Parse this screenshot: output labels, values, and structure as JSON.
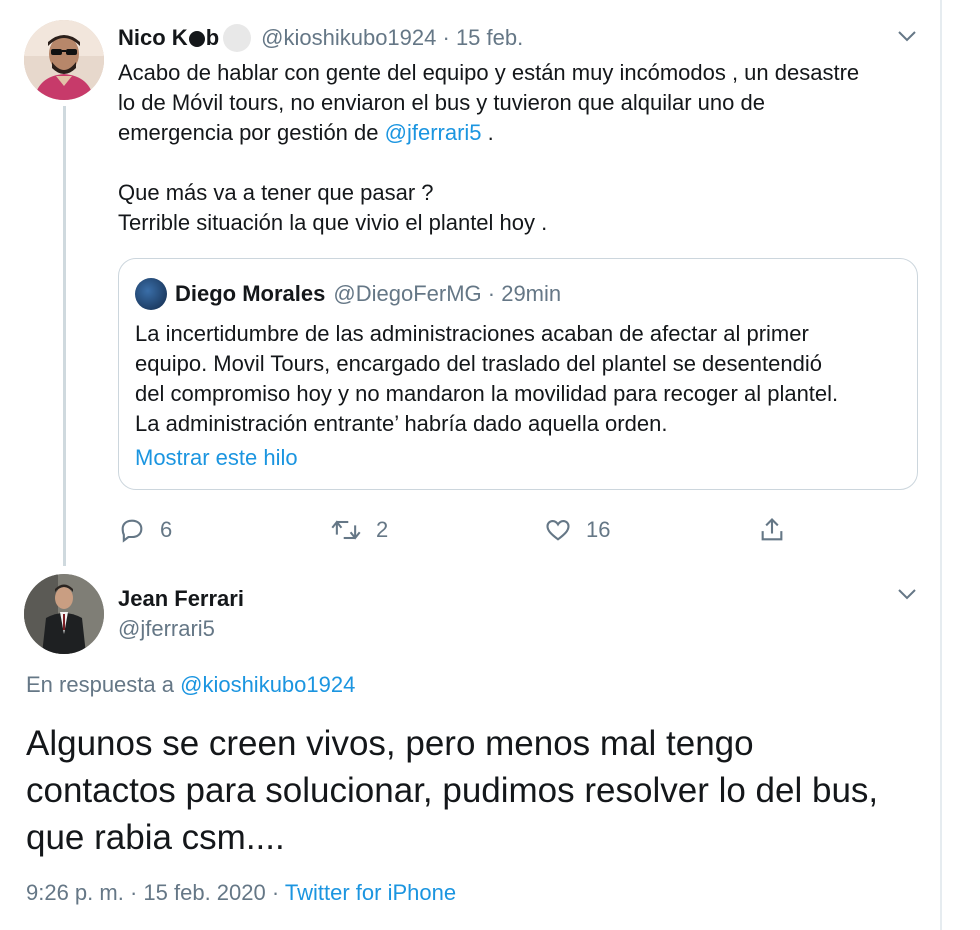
{
  "tweet1": {
    "name": "Nico K",
    "name_tail": "b",
    "handle": "@kioshikubo1924",
    "sep": " · ",
    "date": "15 feb.",
    "text_lines": [
      "Acabo de hablar con gente del equipo y están muy incómodos , un desastre",
      "lo de Móvil tours, no enviaron el bus y tuvieron que alquilar uno de",
      "emergencia por gestión de "
    ],
    "mention": "@jferrari5",
    "after_mention": " .",
    "text2_lines": [
      "Que más va a tener que pasar ?",
      "Terrible situación la que vivio el plantel hoy ."
    ],
    "quote": {
      "name": "Diego Morales",
      "handle": "@DiegoFerMG",
      "sep": " · ",
      "time": "29min",
      "lines": [
        "La incertidumbre de las administraciones acaban de afectar al primer",
        "equipo. Movil Tours, encargado del traslado del plantel se desentendió",
        "del compromiso hoy y no mandaron la movilidad para recoger al plantel.",
        "La administración entrante’ habría dado aquella orden."
      ],
      "show_thread": "Mostrar este hilo"
    },
    "actions": {
      "replies": "6",
      "retweets": "2",
      "likes": "16"
    }
  },
  "tweet2": {
    "name": "Jean Ferrari",
    "handle": "@jferrari5",
    "reply_prefix": "En respuesta a ",
    "reply_handle": "@kioshikubo1924",
    "text_lines": [
      "Algunos se creen vivos, pero menos mal tengo",
      "contactos para solucionar, pudimos resolver lo del bus,",
      "que rabia csm...."
    ],
    "time": "9:26 p. m.",
    "sep1": " · ",
    "date": "15 feb. 2020",
    "sep2": " · ",
    "source": "Twitter for iPhone"
  },
  "icons": {
    "chevron": "chevron-down-icon",
    "reply": "reply-icon",
    "retweet": "retweet-icon",
    "like": "heart-icon",
    "share": "share-icon"
  },
  "colors": {
    "link": "#1b95e0",
    "muted": "#657786",
    "text": "#14171a",
    "border": "#ccd6dd"
  }
}
